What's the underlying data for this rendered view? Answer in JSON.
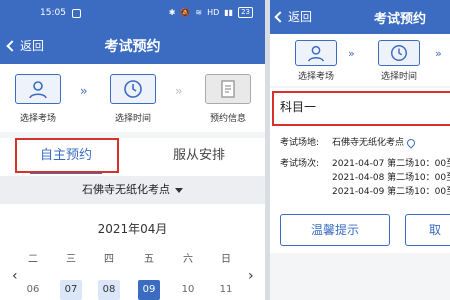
{
  "left": {
    "status": {
      "time": "15:05",
      "battery": "23",
      "net": "HD"
    },
    "navbar": {
      "back": "返回",
      "title": "考试预约"
    },
    "steps": [
      {
        "label": "选择考场",
        "icon": "person-icon"
      },
      {
        "label": "选择时间",
        "icon": "clock-icon"
      },
      {
        "label": "预约信息",
        "icon": "document-icon"
      }
    ],
    "tabs": [
      {
        "label": "自主预约"
      },
      {
        "label": "服从安排"
      }
    ],
    "location": "石佛寺无纸化考点",
    "calendar": {
      "month": "2021年04月",
      "weekdays": [
        "二",
        "三",
        "四",
        "五",
        "六",
        "日"
      ],
      "days": [
        "06",
        "07",
        "08",
        "09",
        "10",
        "11"
      ],
      "selected_day": "09",
      "prev": "‹",
      "next": "›"
    }
  },
  "right": {
    "navbar": {
      "back": "返回",
      "title": "考试预约"
    },
    "steps": [
      {
        "label": "选择考场",
        "icon": "person-icon"
      },
      {
        "label": "选择时间",
        "icon": "clock-icon"
      }
    ],
    "subject": "科目一",
    "venue_label": "考试场地:",
    "venue_value": "石佛寺无纸化考点",
    "session_label": "考试场次:",
    "sessions": [
      "2021-04-07 第二场10：00至",
      "2021-04-08 第二场10：00至",
      "2021-04-09 第二场10：00至"
    ],
    "buttons": {
      "tip": "温馨提示",
      "cancel": "取"
    }
  },
  "colors": {
    "brand": "#3b6cc2",
    "highlight_box": "#d6312b",
    "selected_day": "#3b6cc2",
    "available_day": "#dbe7f8"
  }
}
